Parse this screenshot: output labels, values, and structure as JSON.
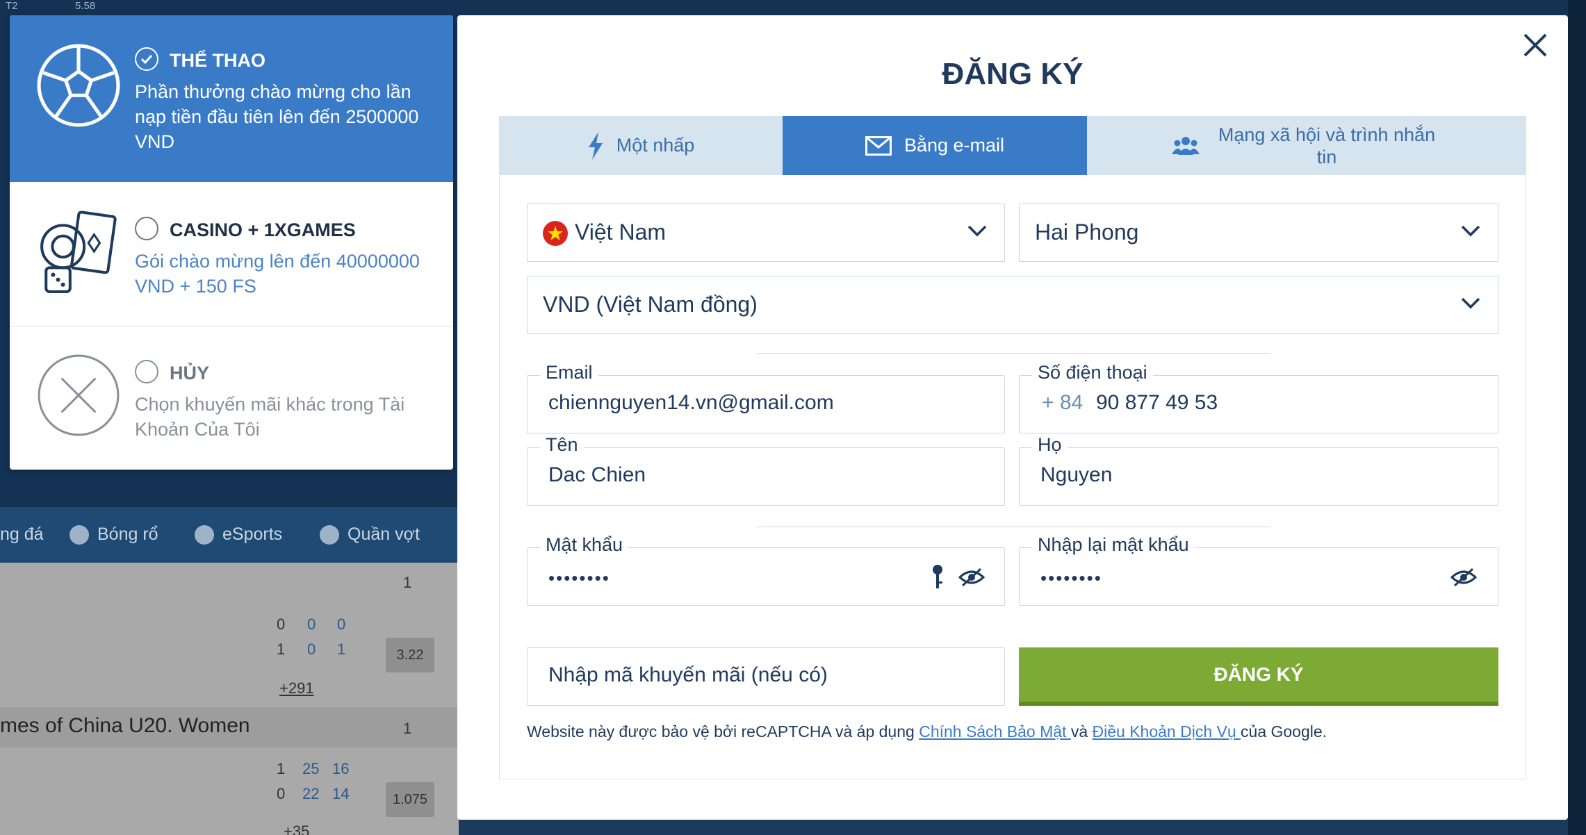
{
  "background": {
    "top_values": [
      "T2",
      "5.58"
    ],
    "nav": [
      "ng đá",
      "Bóng rổ",
      "eSports",
      "Quần vợt"
    ],
    "league": "mes of China U20. Women",
    "rows": [
      {
        "nums": [
          "0",
          "0",
          "0"
        ],
        "col": "1"
      },
      {
        "nums": [
          "1",
          "0",
          "1"
        ],
        "odds": "3.22"
      },
      {
        "more": "+291"
      },
      {
        "nums": [
          "1",
          "25",
          "16"
        ],
        "col": "1"
      },
      {
        "nums": [
          "0",
          "22",
          "14"
        ],
        "odds": "1.075"
      },
      {
        "more": "+35"
      }
    ]
  },
  "bonus": {
    "options": [
      {
        "title": "THỂ THAO",
        "desc": "Phần thưởng chào mừng cho lần nạp tiền đầu tiên lên đến 2500000 VND",
        "selected": true
      },
      {
        "title": "CASINO + 1XGAMES",
        "desc": "Gói chào mừng lên đến 40000000 VND + 150 FS",
        "selected": false
      },
      {
        "title": "HỦY",
        "desc": "Chọn khuyến mãi khác trong Tài Khoản Của Tôi",
        "selected": false
      }
    ]
  },
  "modal": {
    "title": "ĐĂNG KÝ",
    "tabs": [
      {
        "label": "Một nhấp",
        "icon": "lightning-icon"
      },
      {
        "label": "Bằng e-mail",
        "icon": "envelope-icon"
      },
      {
        "label": "Mạng xã hội và trình nhắn tin",
        "icon": "users-icon"
      }
    ],
    "country": "Việt Nam",
    "city": "Hai Phong",
    "currency": "VND (Việt Nam đồng)",
    "email": {
      "label": "Email",
      "value": "chiennguyen14.vn@gmail.com"
    },
    "phone": {
      "label": "Số điện thoại",
      "prefix": "+ 84",
      "value": "90 877 49 53"
    },
    "first_name": {
      "label": "Tên",
      "value": "Dac Chien"
    },
    "last_name": {
      "label": "Họ",
      "value": "Nguyen"
    },
    "password": {
      "label": "Mật khẩu",
      "value": "••••••••"
    },
    "password_repeat": {
      "label": "Nhập lại mật khẩu",
      "value": "••••••••"
    },
    "promo_placeholder": "Nhập mã khuyến mãi (nếu có)",
    "submit": "ĐĂNG KÝ",
    "recaptcha": {
      "prefix": "Website này được bảo vệ bởi reCAPTCHA và áp dụng ",
      "privacy": "Chính Sách Bảo Mật ",
      "and": " và ",
      "terms": "Điều Khoản Dịch Vụ ",
      "suffix": "của Google."
    }
  },
  "colors": {
    "primary": "#3a7bc8",
    "tab_bg": "#d6e4f0",
    "submit": "#7caa35",
    "text": "#1f3a5c"
  }
}
